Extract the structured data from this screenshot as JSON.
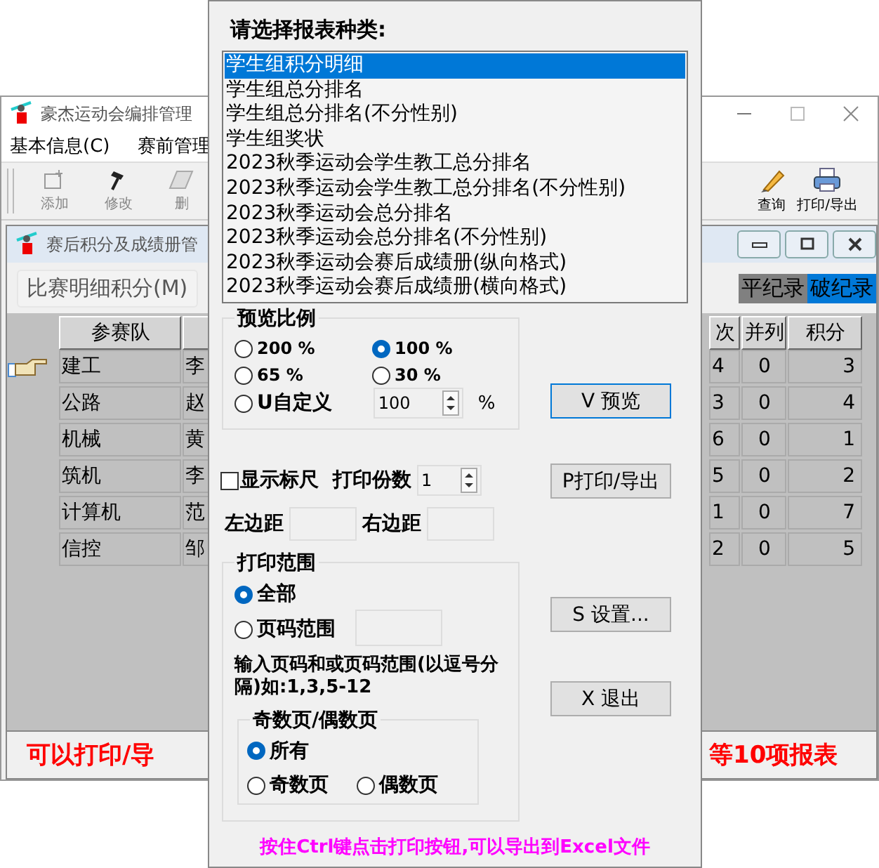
{
  "main_window": {
    "title": "豪杰运动会编排管理",
    "menu": [
      "基本信息(C)",
      "赛前管理"
    ],
    "toolbar_left": [
      {
        "kind": "add",
        "label": "添加",
        "disabled": true
      },
      {
        "kind": "edit",
        "label": "修改",
        "disabled": true
      },
      {
        "kind": "delete",
        "label": "删",
        "disabled": true
      }
    ],
    "toolbar_right": [
      {
        "kind": "search",
        "label": "查询",
        "disabled": false
      },
      {
        "kind": "print",
        "label": "打印/导出",
        "disabled": false
      }
    ]
  },
  "child_window": {
    "title": "赛后积分及成绩册管",
    "tab": "比赛明细积分(M)",
    "record_badges": [
      {
        "label": "平纪录",
        "color": "#808080"
      },
      {
        "label": "破纪录",
        "color": "#0078d7"
      }
    ]
  },
  "grid": {
    "columns_left": [
      "参赛队"
    ],
    "columns_right": [
      "次",
      "并列",
      "积分"
    ],
    "rows": [
      {
        "team": "建工",
        "column_2": "李",
        "rank": "4",
        "tie": "0",
        "score": "3",
        "current": true
      },
      {
        "team": "公路",
        "column_2": "赵",
        "rank": "3",
        "tie": "0",
        "score": "4",
        "current": false
      },
      {
        "team": "机械",
        "column_2": "黄",
        "rank": "6",
        "tie": "0",
        "score": "1",
        "current": false
      },
      {
        "team": "筑机",
        "column_2": "李",
        "rank": "5",
        "tie": "0",
        "score": "2",
        "current": false
      },
      {
        "team": "计算机",
        "column_2": "范",
        "rank": "1",
        "tie": "0",
        "score": "7",
        "current": false
      },
      {
        "team": "信控",
        "column_2": "邹",
        "rank": "2",
        "tie": "0",
        "score": "5",
        "current": false
      }
    ]
  },
  "status_left": "可以打印/导",
  "status_right": "等10项报表",
  "dialog": {
    "prompt": "请选择报表种类:",
    "reports": [
      {
        "label": "学生组积分明细",
        "selected": true
      },
      {
        "label": "学生组总分排名",
        "selected": false
      },
      {
        "label": "学生组总分排名(不分性别)",
        "selected": false
      },
      {
        "label": "学生组奖状",
        "selected": false
      },
      {
        "label": "2023秋季运动会学生教工总分排名",
        "selected": false
      },
      {
        "label": "2023秋季运动会学生教工总分排名(不分性别)",
        "selected": false
      },
      {
        "label": "2023秋季运动会总分排名",
        "selected": false
      },
      {
        "label": "2023秋季运动会总分排名(不分性别)",
        "selected": false
      },
      {
        "label": "2023秋季运动会赛后成绩册(纵向格式)",
        "selected": false
      },
      {
        "label": "2023秋季运动会赛后成绩册(横向格式)",
        "selected": false
      }
    ],
    "preview": {
      "title": "预览比例",
      "options": [
        {
          "label": "200 %",
          "selected": false
        },
        {
          "label": "100 %",
          "selected": true
        },
        {
          "label": " 65 %",
          "selected": false
        },
        {
          "label": " 30 %",
          "selected": false
        },
        {
          "label": "U自定义",
          "selected": false
        }
      ],
      "custom_value": "100",
      "unit": "%"
    },
    "show_ruler": {
      "label": "显示标尺",
      "checked": false
    },
    "copies": {
      "label": "打印份数",
      "value": "1"
    },
    "left_margin": "左边距",
    "right_margin": "右边距",
    "range": {
      "title": "打印范围",
      "options": [
        {
          "label": "全部",
          "selected": true
        },
        {
          "label": "页码范围",
          "selected": false
        }
      ],
      "hint": "输入页码和或页码范围(以逗号分隔)如:1,3,5-12",
      "parity": {
        "title": "奇数页/偶数页",
        "options": [
          {
            "label": "所有",
            "selected": true
          },
          {
            "label": "奇数页",
            "selected": false
          },
          {
            "label": "偶数页",
            "selected": false
          }
        ]
      }
    },
    "buttons": [
      "V 预览",
      "P打印/导出",
      "S 设置...",
      "X 退出"
    ],
    "footer": "按住Ctrl键点击打印按钮,可以导出到Excel文件"
  }
}
